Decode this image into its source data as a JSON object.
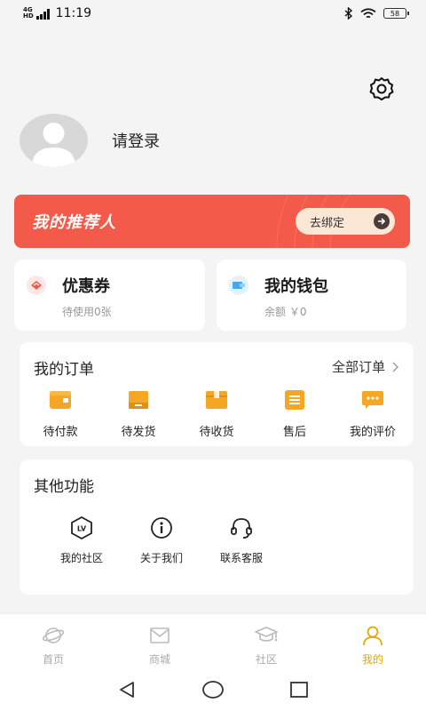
{
  "status_bar": {
    "network": "4G",
    "network_sub": "HD",
    "time": "11:19",
    "battery": "58"
  },
  "profile": {
    "login_label": "请登录"
  },
  "referrer": {
    "title": "我的推荐人",
    "bind_label": "去绑定"
  },
  "coupon": {
    "title": "优惠券",
    "subtitle": "待使用0张"
  },
  "wallet": {
    "title": "我的钱包",
    "subtitle": "余额 ￥0"
  },
  "orders": {
    "title": "我的订单",
    "all_label": "全部订单",
    "items": [
      {
        "label": "待付款",
        "icon": "wallet-icon"
      },
      {
        "label": "待发货",
        "icon": "box-icon"
      },
      {
        "label": "待收货",
        "icon": "package-icon"
      },
      {
        "label": "售后",
        "icon": "list-icon"
      },
      {
        "label": "我的评价",
        "icon": "comment-icon"
      }
    ]
  },
  "other": {
    "title": "其他功能",
    "items": [
      {
        "label": "我的社区",
        "icon": "lv-badge-icon"
      },
      {
        "label": "关于我们",
        "icon": "info-icon"
      },
      {
        "label": "联系客服",
        "icon": "headset-icon"
      }
    ]
  },
  "tabs": [
    {
      "label": "首页",
      "icon": "planet-icon"
    },
    {
      "label": "商城",
      "icon": "mail-icon"
    },
    {
      "label": "社区",
      "icon": "graduation-cap-icon"
    },
    {
      "label": "我的",
      "icon": "person-icon",
      "active": true
    }
  ],
  "colors": {
    "accent": "#e2a900",
    "banner": "#f35a4a",
    "order_icon": "#f5a623"
  }
}
